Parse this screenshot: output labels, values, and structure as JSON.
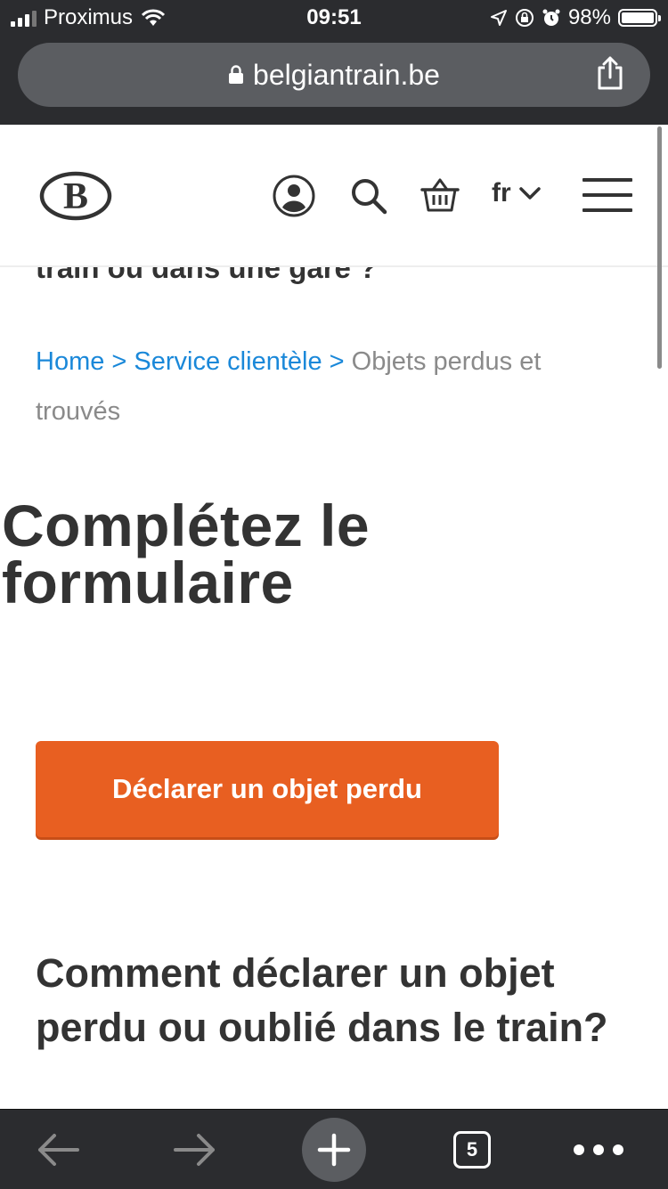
{
  "status_bar": {
    "carrier": "Proximus",
    "time": "09:51",
    "battery": "98%"
  },
  "browser": {
    "url": "belgiantrain.be",
    "tab_count": "5"
  },
  "header": {
    "logo_text": "B",
    "language": "fr"
  },
  "content": {
    "partial_heading": "train ou dans une gare ?",
    "breadcrumb": {
      "home": "Home",
      "separator": ">",
      "service": "Service clientèle",
      "current": "Objets perdus et trouvés"
    },
    "title": "Complétez le formulaire",
    "cta_label": "Déclarer un objet perdu",
    "sub_heading": "Comment déclarer un objet perdu ou oublié dans le train?"
  },
  "colors": {
    "accent": "#e85f21",
    "link": "#1a88d9",
    "text": "#333333",
    "chrome": "#2b2c2f"
  },
  "icons": [
    "signal-icon",
    "wifi-icon",
    "location-icon",
    "orientation-lock-icon",
    "alarm-icon",
    "battery-icon",
    "lock-icon",
    "share-icon",
    "user-icon",
    "search-icon",
    "basket-icon",
    "chevron-down-icon",
    "menu-icon",
    "back-icon",
    "forward-icon",
    "plus-icon",
    "tabs-icon",
    "more-icon"
  ]
}
